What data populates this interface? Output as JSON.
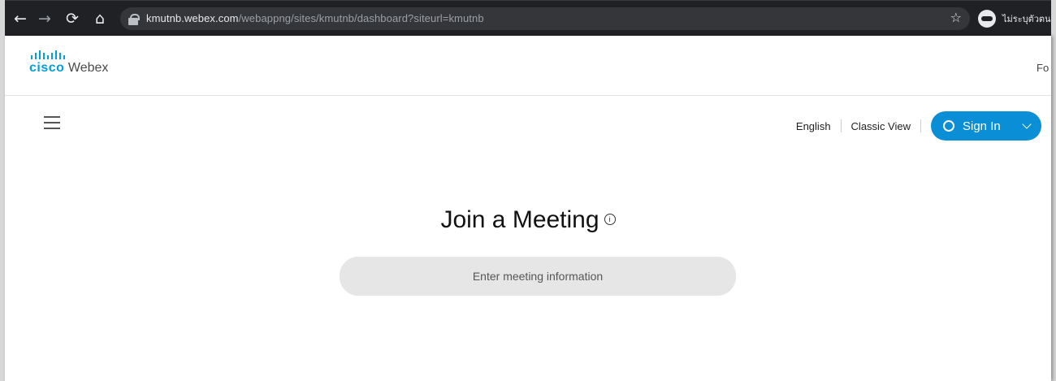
{
  "browser": {
    "url_host": "kmutnb.webex.com",
    "url_path": "/webappng/sites/kmutnb/dashboard?siteurl=kmutnb",
    "profile_label": "ไม่ระบุตัวตน",
    "icons": [
      "back-icon",
      "forward-icon",
      "reload-icon",
      "home-icon",
      "lock-icon",
      "star-icon",
      "incognito-icon"
    ]
  },
  "header": {
    "brand_cisco": "cisco",
    "brand_product": "Webex",
    "cut_text": "Fo"
  },
  "nav": {
    "language": "English",
    "classic_view": "Classic View",
    "sign_in": "Sign In"
  },
  "main": {
    "title": "Join a Meeting",
    "info_glyph": "i",
    "input_placeholder": "Enter meeting information"
  },
  "colors": {
    "accent": "#0a8fd7",
    "cisco_blue": "#049fd9",
    "chrome_bg": "#202124",
    "input_bg": "#e6e6e6"
  }
}
